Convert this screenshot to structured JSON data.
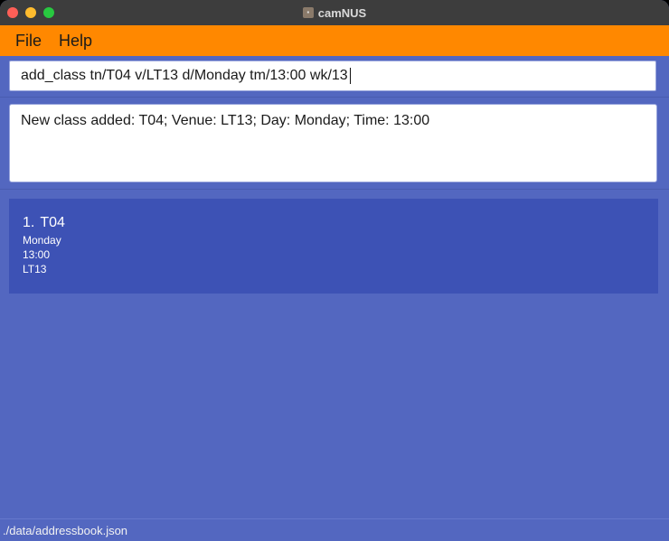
{
  "window": {
    "title": "camNUS",
    "icon": "camnus-app-icon"
  },
  "menu": {
    "items": [
      {
        "label": "File"
      },
      {
        "label": "Help"
      }
    ]
  },
  "command": {
    "value": "add_class tn/T04 v/LT13 d/Monday tm/13:00 wk/13"
  },
  "result": {
    "message": "New class added: T04; Venue: LT13; Day: Monday; Time: 13:00"
  },
  "class_list": [
    {
      "index": "1.",
      "name": "T04",
      "day": "Monday",
      "time": "13:00",
      "venue": "LT13"
    }
  ],
  "status": {
    "path": "./data/addressbook.json"
  },
  "colors": {
    "menubar": "#ff8800",
    "background": "#5367c0",
    "card": "#3d52b5"
  }
}
